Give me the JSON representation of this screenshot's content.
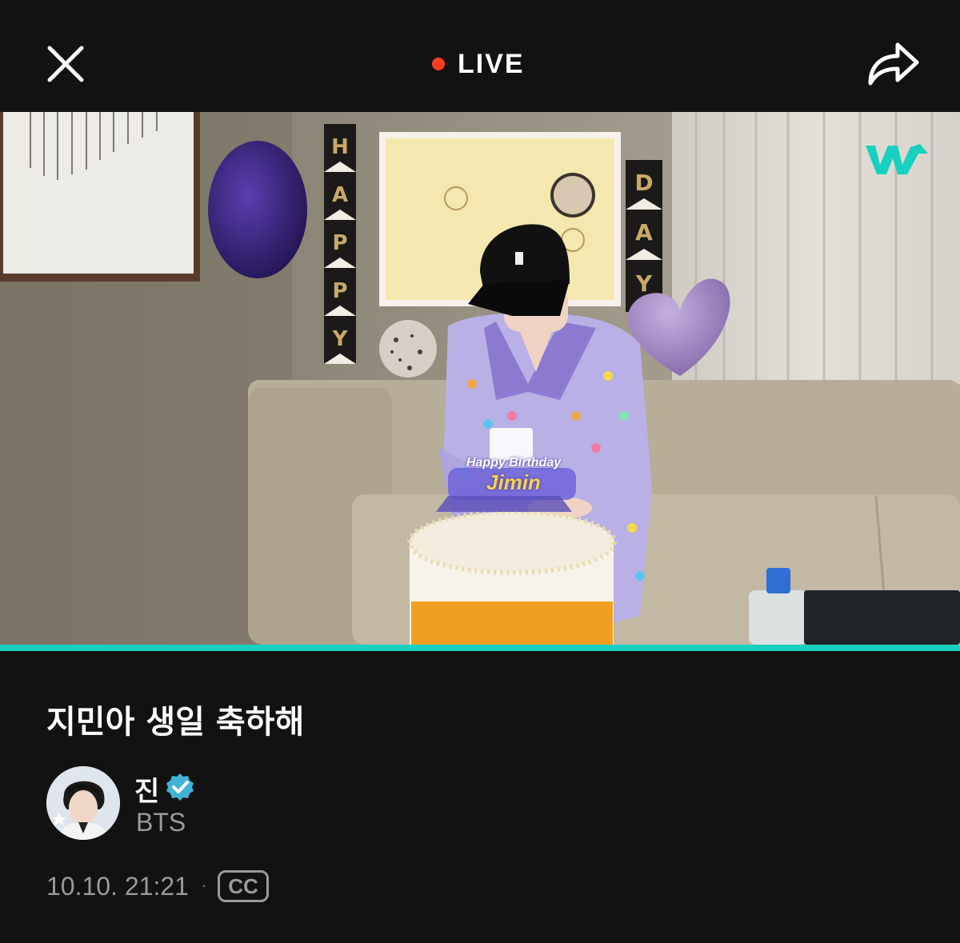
{
  "header": {
    "live_label": "LIVE",
    "close_icon": "close-icon",
    "share_icon": "share-icon"
  },
  "video": {
    "logo_icon": "weverse-logo",
    "overlay_line1": "Happy Birthday",
    "overlay_line2": "Jimin",
    "banner_letters": [
      "H",
      "A",
      "P",
      "P",
      "Y",
      "D",
      "A",
      "Y"
    ],
    "progress": 1.0
  },
  "info": {
    "title": "지민아 생일 축하해",
    "artist_name": "진",
    "artist_group": "BTS",
    "timestamp": "10.10. 21:21",
    "separator": "·",
    "cc_label": "CC"
  },
  "colors": {
    "background": "#121212",
    "live_dot": "#ff3d1f",
    "accent": "#17d1c0",
    "secondary_text": "#9a9a9a",
    "verified": "#3fb3d6"
  }
}
